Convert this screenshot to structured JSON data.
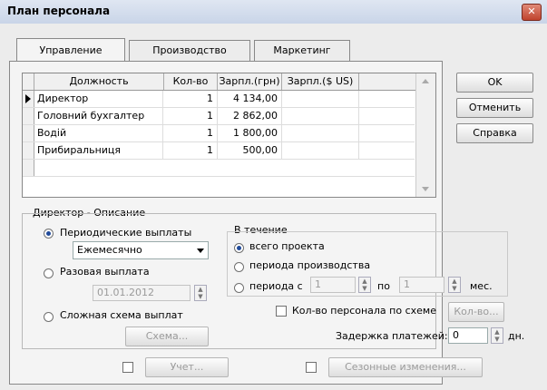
{
  "window": {
    "title": "План персонала",
    "close_glyph": "✕"
  },
  "tabs": [
    {
      "label": "Управление"
    },
    {
      "label": "Производство"
    },
    {
      "label": "Маркетинг"
    }
  ],
  "grid": {
    "columns": [
      "Должность",
      "Кол-во",
      "Зарпл.(грн)",
      "Зарпл.($ US)"
    ],
    "rows": [
      {
        "position": "Директор",
        "qty": "1",
        "salary_uah": "4 134,00",
        "salary_usd": ""
      },
      {
        "position": "Головний бухгалтер",
        "qty": "1",
        "salary_uah": "2 862,00",
        "salary_usd": ""
      },
      {
        "position": "Водій",
        "qty": "1",
        "salary_uah": "1 800,00",
        "salary_usd": ""
      },
      {
        "position": "Прибиральниця",
        "qty": "1",
        "salary_uah": "500,00",
        "salary_usd": ""
      }
    ],
    "selected_row": 0
  },
  "buttons": {
    "ok": "OK",
    "cancel": "Отменить",
    "help": "Справка"
  },
  "description": {
    "title": "Директор - Описание",
    "periodic_label": "Периодические выплаты",
    "periodic_selected": "Ежемесячно",
    "one_time_label": "Разовая выплата",
    "one_time_date": "01.01.2012",
    "complex_label": "Сложная схема выплат",
    "scheme_button": "Схема...",
    "during": {
      "title": "В течение",
      "whole_project": "всего проекта",
      "production_period": "периода производства",
      "period_from": "периода с",
      "from_value": "1",
      "to_label": "по",
      "to_value": "1",
      "unit": "мес."
    },
    "staff_by_scheme_label": "Кол-во персонала по схеме",
    "staff_button": "Кол-во...",
    "delay_label": "Задержка платежей:",
    "delay_value": "0",
    "delay_unit": "дн."
  },
  "bottom": {
    "account_button": "Учет...",
    "seasonal_button": "Сезонные изменения..."
  }
}
